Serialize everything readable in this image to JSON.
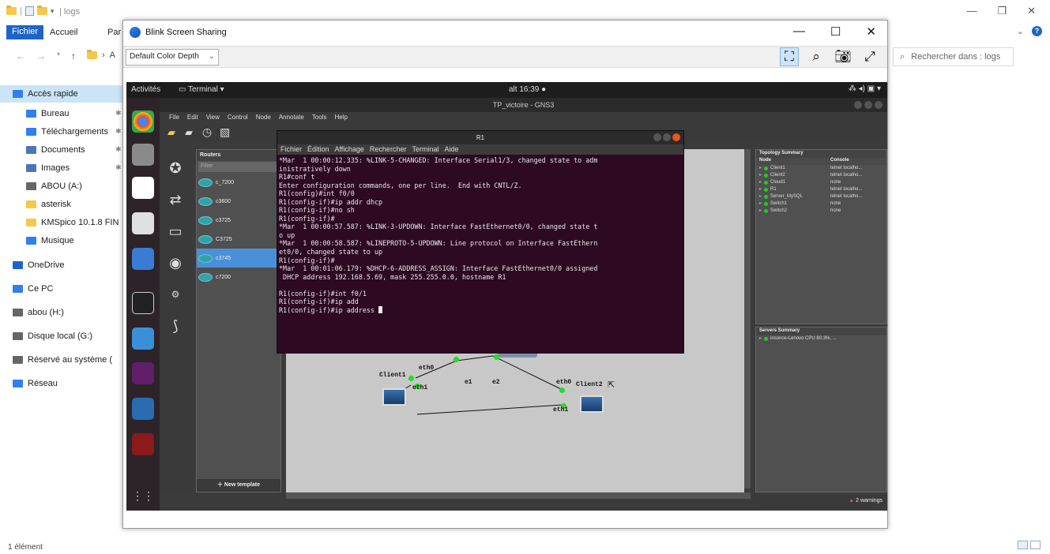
{
  "explorer": {
    "title": "logs",
    "tabs": [
      "Fichier",
      "Accueil",
      "Par"
    ],
    "address_crumb": "A",
    "search_placeholder": "Rechercher dans : logs",
    "sidebar": [
      {
        "label": "Accès rapide",
        "icon": "star-icon",
        "color": "#2f80ed"
      },
      {
        "label": "Bureau",
        "icon": "desktop-icon",
        "color": "#2f80ed"
      },
      {
        "label": "Téléchargements",
        "icon": "download-icon",
        "color": "#2f80ed"
      },
      {
        "label": "Documents",
        "icon": "document-icon",
        "color": "#4a76b8"
      },
      {
        "label": "Images",
        "icon": "image-icon",
        "color": "#4a76b8"
      },
      {
        "label": "ABOU (A:)",
        "icon": "drive-icon",
        "color": "#666666"
      },
      {
        "label": "asterisk",
        "icon": "folder-icon",
        "color": "#f2c94c"
      },
      {
        "label": "KMSpico 10.1.8 FIN",
        "icon": "folder-icon",
        "color": "#f2c94c"
      },
      {
        "label": "Musique",
        "icon": "music-icon",
        "color": "#2f80ed"
      },
      {
        "label": "OneDrive",
        "icon": "cloud-icon",
        "color": "#1e64c8"
      },
      {
        "label": "Ce PC",
        "icon": "computer-icon",
        "color": "#2f80ed"
      },
      {
        "label": "abou (H:)",
        "icon": "drive-icon",
        "color": "#666666"
      },
      {
        "label": "Disque local (G:)",
        "icon": "drive-icon",
        "color": "#666666"
      },
      {
        "label": "Réservé au système (",
        "icon": "drive-icon",
        "color": "#666666"
      },
      {
        "label": "Réseau",
        "icon": "network-icon",
        "color": "#2f80ed"
      }
    ],
    "status": "1 élément"
  },
  "blink": {
    "title": "Blink Screen Sharing",
    "color_depth": "Default Color Depth"
  },
  "ubuntu": {
    "activites": "Activités",
    "terminal_menu": "Terminal ▾",
    "clock": "alt 16:39 ●",
    "tray": "⁂ ◂) ▣ ▾"
  },
  "gns3": {
    "title": "TP_victoire - GNS3",
    "menu": [
      "File",
      "Edit",
      "View",
      "Control",
      "Node",
      "Annotate",
      "Tools",
      "Help"
    ],
    "routers_header": "Routers",
    "filter_placeholder": "Filter",
    "routers": [
      "c_7200",
      "c3600",
      "c3725",
      "C3725",
      "c3745",
      "c7200"
    ],
    "new_template": "New template",
    "topology_header": "Topology Summary",
    "topology_cols": [
      "Node",
      "Console"
    ],
    "topology": [
      {
        "node": "Client1",
        "console": "telnet localho..."
      },
      {
        "node": "Client2",
        "console": "telnet localho..."
      },
      {
        "node": "Cloud1",
        "console": "none"
      },
      {
        "node": "R1",
        "console": "telnet localho..."
      },
      {
        "node": "Server_MySQL",
        "console": "telnet localho..."
      },
      {
        "node": "Switch1",
        "console": "none"
      },
      {
        "node": "Switch2",
        "console": "none"
      }
    ],
    "servers_header": "Servers Summary",
    "servers": [
      "insonce-Lenovo CPU 80.3%, ..."
    ],
    "warnings": "2 warnings",
    "canvas_labels": {
      "client1": "Client1",
      "client2": "Client2",
      "eth0_a": "eth0",
      "eth1_a": "eth1",
      "e1": "e1",
      "e2": "e2",
      "eth0_b": "eth0",
      "eth1_b": "eth1"
    }
  },
  "r1": {
    "title": "R1",
    "menu": [
      "Fichier",
      "Édition",
      "Affichage",
      "Rechercher",
      "Terminal",
      "Aide"
    ],
    "lines": [
      "*Mar  1 00:00:12.335: %LINK-5-CHANGED: Interface Serial1/3, changed state to adm",
      "inistratively down",
      "R1#conf t",
      "Enter configuration commands, one per line.  End with CNTL/Z.",
      "R1(config)#int f0/0",
      "R1(config-if)#ip addr dhcp",
      "R1(config-if)#no sh",
      "R1(config-if)#",
      "*Mar  1 00:00:57.587: %LINK-3-UPDOWN: Interface FastEthernet0/0, changed state t",
      "o up",
      "*Mar  1 00:00:58.587: %LINEPROTO-5-UPDOWN: Line protocol on Interface FastEthern",
      "et0/0, changed state to up",
      "R1(config-if)#",
      "*Mar  1 00:01:06.179: %DHCP-6-ADDRESS_ASSIGN: Interface FastEthernet0/0 assigned",
      " DHCP address 192.168.5.69, mask 255.255.0.0, hostname R1",
      "",
      "R1(config-if)#int f0/1",
      "R1(config-if)#ip add",
      "R1(config-if)#ip address "
    ]
  }
}
